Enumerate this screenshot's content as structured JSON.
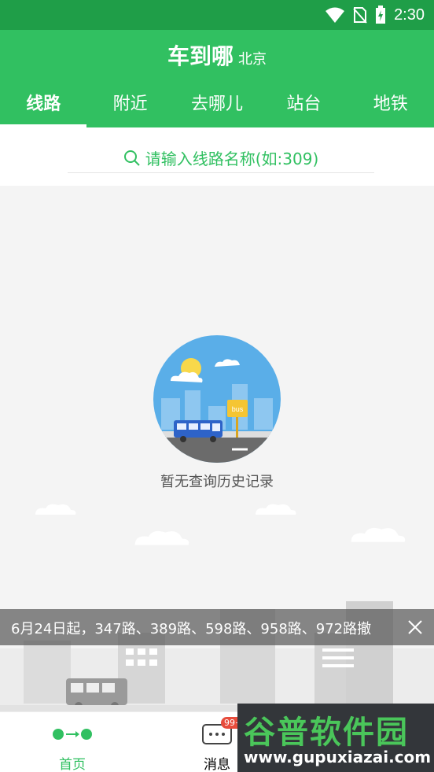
{
  "status_bar": {
    "time": "2:30"
  },
  "header": {
    "title": "车到哪",
    "city": "北京"
  },
  "tabs": [
    "线路",
    "附近",
    "去哪儿",
    "站台",
    "地铁"
  ],
  "search": {
    "placeholder": "请输入线路名称(如:309)"
  },
  "empty_state": {
    "message": "暂无查询历史记录",
    "sign": "bus"
  },
  "ticker": {
    "text": "6月24日起，347路、389路、598路、958路、972路撤"
  },
  "bottom_nav": {
    "items": [
      {
        "label": "首页",
        "active": true
      },
      {
        "label": "消息",
        "badge": "99+"
      }
    ]
  },
  "watermark": {
    "name": "谷普软件园",
    "url": "www.gupuxiazai.com"
  },
  "colors": {
    "primary": "#31c061",
    "status_bar": "#1f9e48"
  }
}
